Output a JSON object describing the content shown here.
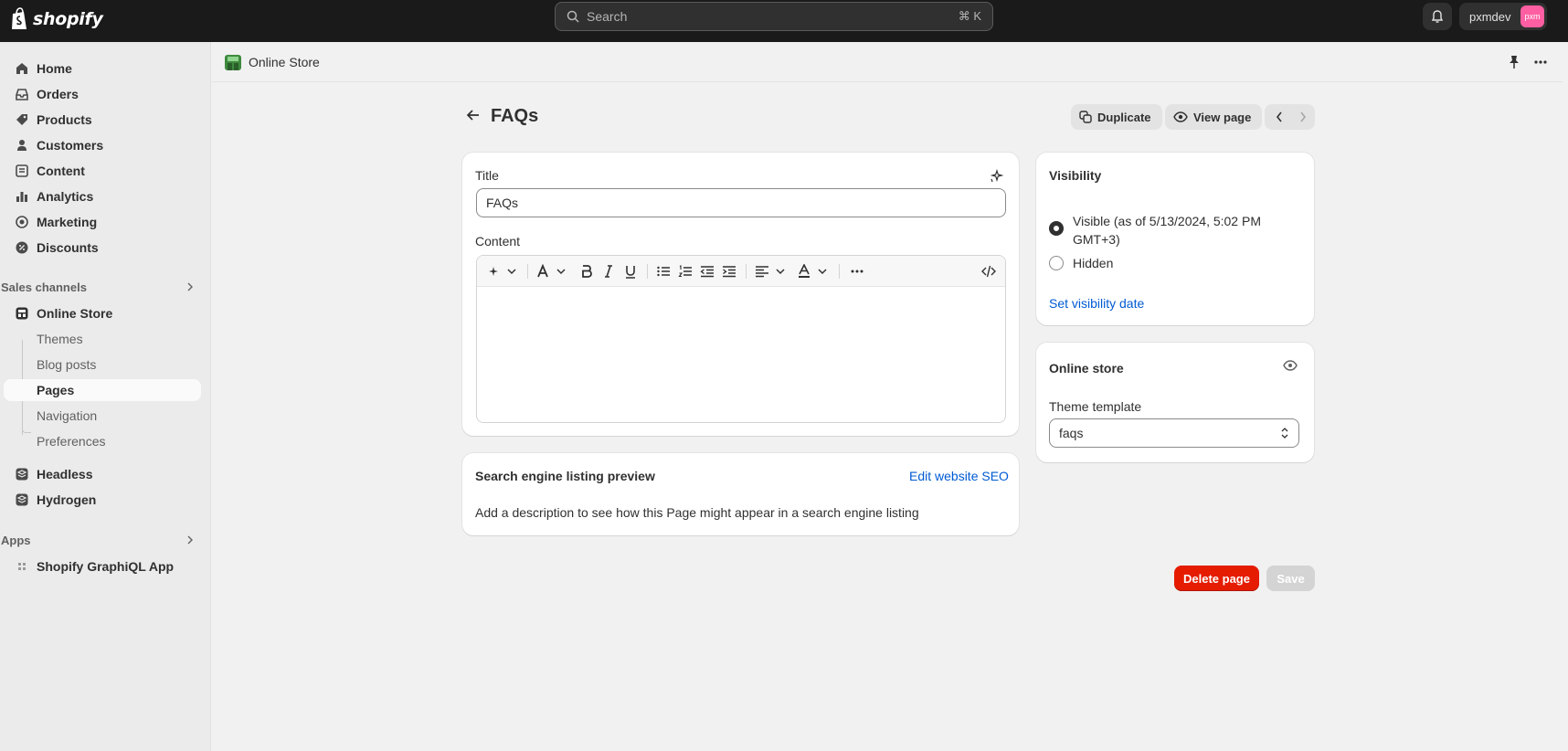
{
  "topbar": {
    "logo_text": "shopify",
    "search_placeholder": "Search",
    "search_shortcut": "⌘ K",
    "account_name": "pxmdev",
    "avatar_initials": "pxm"
  },
  "sidebar": {
    "main_items": [
      {
        "label": "Home",
        "icon": "home-icon"
      },
      {
        "label": "Orders",
        "icon": "inbox-icon"
      },
      {
        "label": "Products",
        "icon": "tag-icon"
      },
      {
        "label": "Customers",
        "icon": "person-icon"
      },
      {
        "label": "Content",
        "icon": "content-icon"
      },
      {
        "label": "Analytics",
        "icon": "chart-icon"
      },
      {
        "label": "Marketing",
        "icon": "target-icon"
      },
      {
        "label": "Discounts",
        "icon": "discount-icon"
      }
    ],
    "sales_channels_label": "Sales channels",
    "online_store_label": "Online Store",
    "online_store_sub": [
      "Themes",
      "Blog posts",
      "Pages",
      "Navigation",
      "Preferences"
    ],
    "active_sub": "Pages",
    "other_channels": [
      "Headless",
      "Hydrogen"
    ],
    "apps_label": "Apps",
    "apps": [
      "Shopify GraphiQL App"
    ]
  },
  "page_header": {
    "title": "Online Store"
  },
  "page": {
    "title": "FAQs",
    "duplicate_label": "Duplicate",
    "view_page_label": "View page"
  },
  "main_card": {
    "title_label": "Title",
    "title_value": "FAQs",
    "content_label": "Content"
  },
  "seo_card": {
    "heading": "Search engine listing preview",
    "edit_link": "Edit website SEO",
    "description": "Add a description to see how this Page might appear in a search engine listing"
  },
  "visibility_card": {
    "heading": "Visibility",
    "visible_line1": "Visible (as of 5/13/2024, 5:02 PM",
    "visible_line2": "GMT+3)",
    "hidden_label": "Hidden",
    "selected": "visible",
    "set_date_link": "Set visibility date"
  },
  "online_store_card": {
    "heading": "Online store",
    "theme_template_label": "Theme template",
    "theme_template_value": "faqs"
  },
  "footer": {
    "delete_label": "Delete page",
    "save_label": "Save"
  },
  "colors": {
    "topbar": "#1a1a1a",
    "danger": "#e51c00",
    "link": "#005bd3"
  }
}
